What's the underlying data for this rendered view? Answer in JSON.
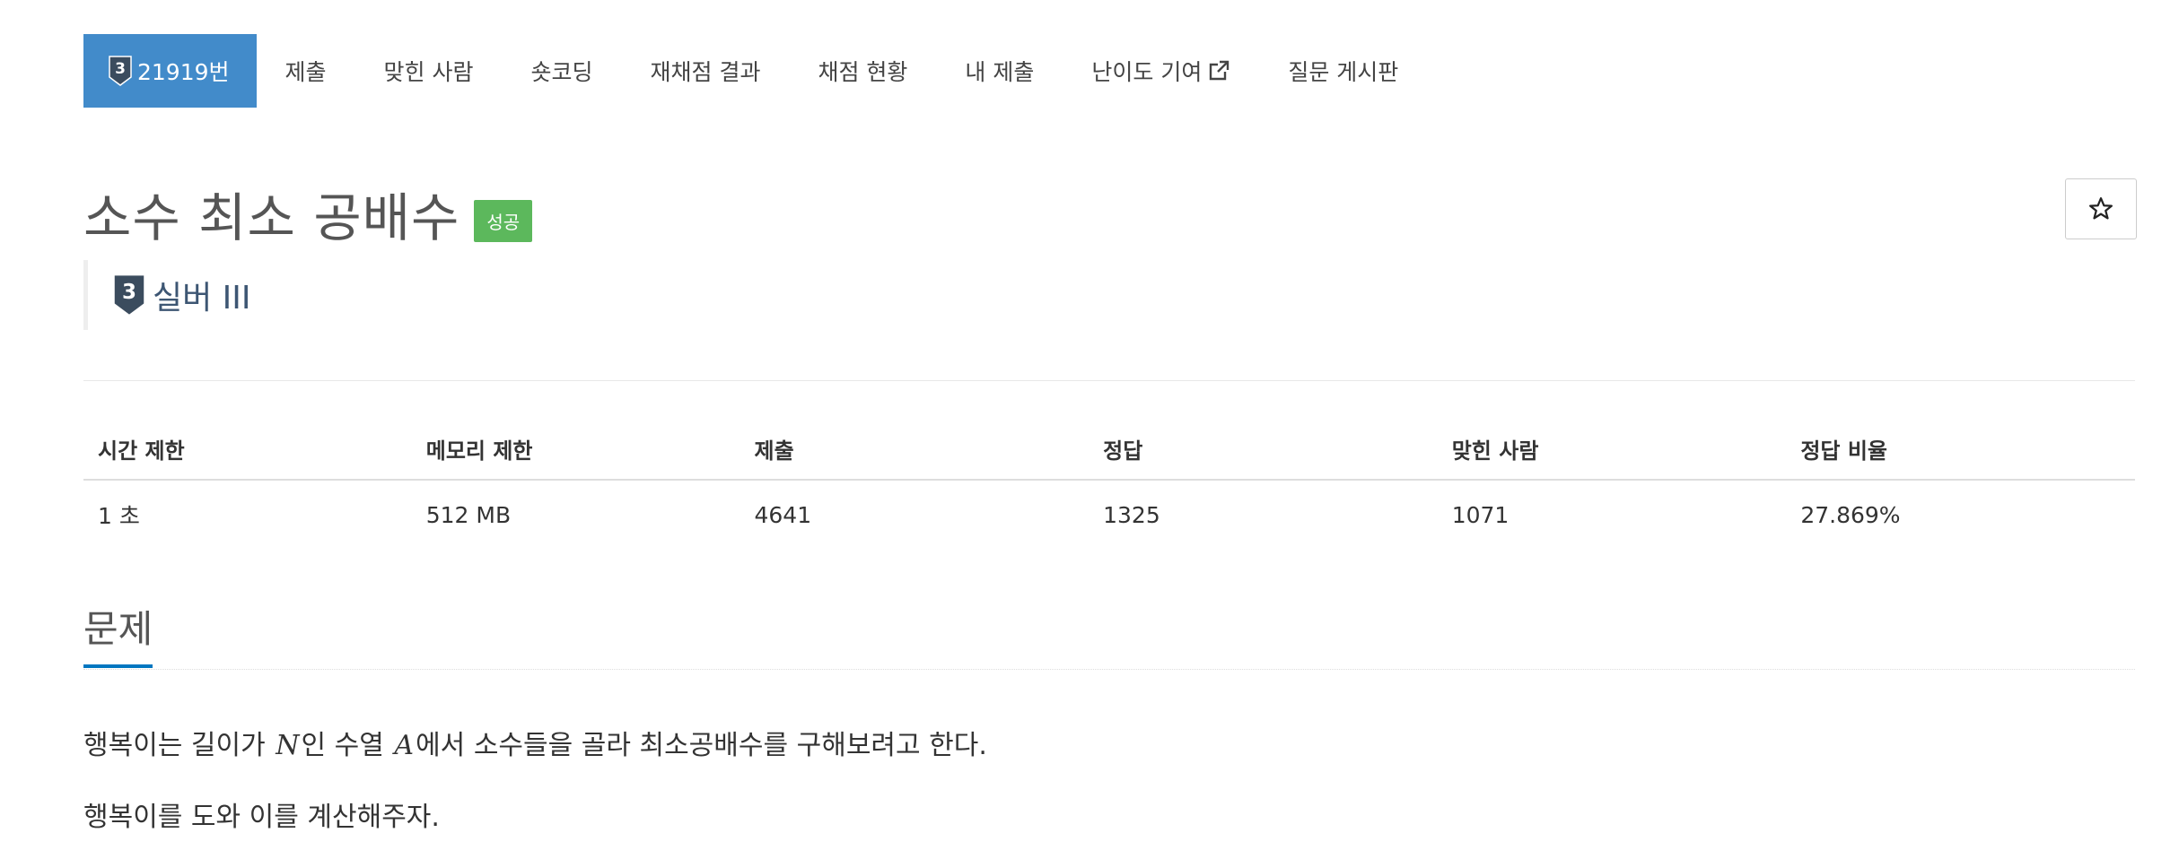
{
  "nav": {
    "problem_tab": "21919번",
    "submit": "제출",
    "solvers": "맞힌 사람",
    "shortcoding": "숏코딩",
    "rejudge": "재채점 결과",
    "status": "채점 현황",
    "my_submissions": "내 제출",
    "difficulty": "난이도 기여",
    "board": "질문 게시판"
  },
  "problem": {
    "title": "소수 최소 공배수",
    "result_label": "성공",
    "tier_number": "3",
    "tier_text": "실버 III"
  },
  "info_table": {
    "headers": [
      "시간 제한",
      "메모리 제한",
      "제출",
      "정답",
      "맞힌 사람",
      "정답 비율"
    ],
    "values": [
      "1 초",
      "512 MB",
      "4641",
      "1325",
      "1071",
      "27.869%"
    ]
  },
  "section": {
    "title": "문제",
    "line1_before": "행복이는 길이가 ",
    "var_n": "N",
    "line1_mid": "인 수열 ",
    "var_a": "A",
    "line1_after": "에서 소수들을 골라 최소공배수를 구해보려고 한다.",
    "line2": "행복이를 도와 이를 계산해주자."
  },
  "icons": {
    "tier": "silver-tier-icon",
    "external": "external-link-icon",
    "star": "star-icon"
  },
  "colors": {
    "nav_active": "#428bca",
    "success": "#5cb85c",
    "tier_text": "#3d5673",
    "section_underline": "#0076c0"
  }
}
